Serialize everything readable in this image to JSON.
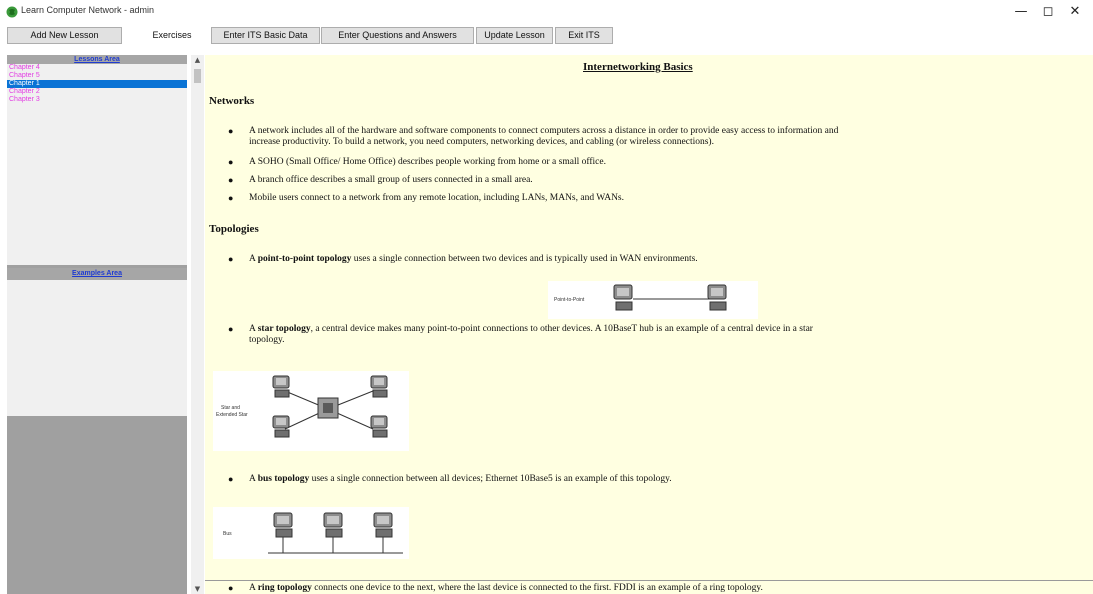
{
  "window": {
    "title": "Learn Computer Network  - admin",
    "minimize": "—",
    "maximize": "◻",
    "close": "✕"
  },
  "toolbar": {
    "add_new_lesson": "Add New Lesson",
    "exercises": "Exercises",
    "enter_its_basic_data": "Enter ITS Basic Data",
    "enter_questions": "Enter Questions and Answers",
    "update_lesson": "Update Lesson",
    "exit_its": "Exit ITS"
  },
  "lessons_panel": {
    "header": "Lessons Area",
    "items": [
      "Chapter 4",
      "Chapter 5",
      "Chapter 1",
      "Chapter 2",
      "Chapter 3"
    ],
    "selected_index": 2
  },
  "examples_panel": {
    "header": "Examples Area"
  },
  "content": {
    "title": "Internetworking Basics",
    "networks_heading": "Networks",
    "networks_bullets": [
      "A network includes all of the hardware and software components to connect computers across a distance in order to provide easy access to information and",
      "increase productivity. To build a network, you need computers, networking devices, and cabling (or wireless connections).",
      "A SOHO (Small Office/ Home Office) describes people working from home or a small office.",
      "A branch office describes a small group of users connected in a small area.",
      "Mobile users connect to a network from any remote location, including LANs, MANs, and WANs."
    ],
    "topologies_heading": "Topologies",
    "p2p_bold": "point-to-point topology",
    "p2p_rest": " uses a single connection between two devices and is typically used in WAN environments.",
    "p2p_caption": "Point-to-Point",
    "star_bold": "star topology",
    "star_rest": ", a central device makes many point-to-point connections to other devices. A 10BaseT hub is an example of a central device in a star",
    "star_rest2": "topology.",
    "star_caption1": "Star and",
    "star_caption2": "Extended Star",
    "bus_bold": "bus topology",
    "bus_rest": " uses a single connection between all devices; Ethernet 10Base5 is an example of this topology.",
    "bus_caption": "Bus",
    "ring_bold": "ring topology",
    "ring_rest": " connects one device to the next, where the last device is connected to the first. FDDI is an example of a ring topology.",
    "article": "A"
  },
  "scrollbar": {
    "up": "▲",
    "down": "▼"
  }
}
